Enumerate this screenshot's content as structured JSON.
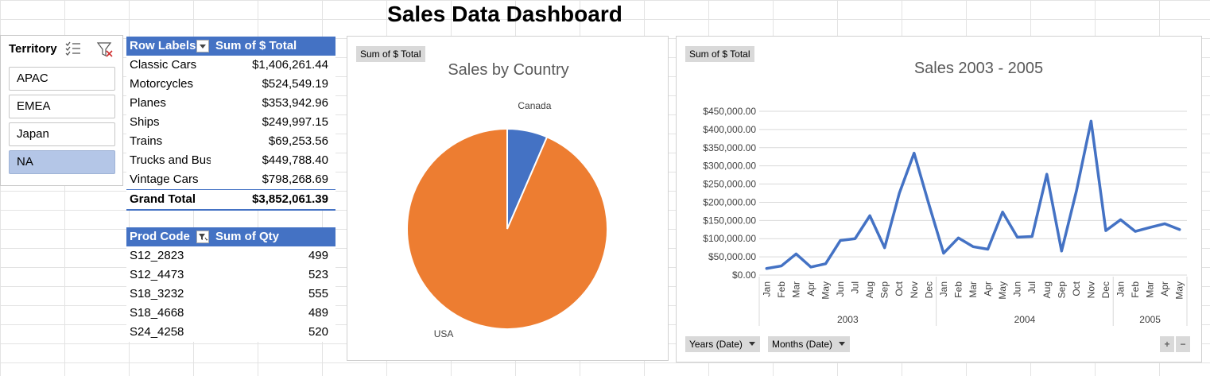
{
  "title": "Sales Data Dashboard",
  "slicer": {
    "header": "Territory",
    "items": [
      {
        "label": "APAC",
        "selected": false
      },
      {
        "label": "EMEA",
        "selected": false
      },
      {
        "label": "Japan",
        "selected": false
      },
      {
        "label": "NA",
        "selected": true
      }
    ]
  },
  "pivot1": {
    "col1": "Row Labels",
    "col2": "Sum of $ Total",
    "rows": [
      {
        "label": "Classic Cars",
        "value": "$1,406,261.44"
      },
      {
        "label": "Motorcycles",
        "value": "$524,549.19"
      },
      {
        "label": "Planes",
        "value": "$353,942.96"
      },
      {
        "label": "Ships",
        "value": "$249,997.15"
      },
      {
        "label": "Trains",
        "value": "$69,253.56"
      },
      {
        "label": "Trucks and Buses",
        "value": "$449,788.40"
      },
      {
        "label": "Vintage Cars",
        "value": "$798,268.69"
      }
    ],
    "grand_label": "Grand Total",
    "grand_value": "$3,852,061.39"
  },
  "pivot2": {
    "col1": "Prod Code",
    "col2": "Sum of Qty",
    "rows": [
      {
        "label": "S12_2823",
        "value": "499"
      },
      {
        "label": "S12_4473",
        "value": "523"
      },
      {
        "label": "S18_3232",
        "value": "555"
      },
      {
        "label": "S18_4668",
        "value": "489"
      },
      {
        "label": "S24_4258",
        "value": "520"
      }
    ]
  },
  "pie_panel": {
    "field_button": "Sum of $ Total"
  },
  "line_panel": {
    "field_button": "Sum of $ Total",
    "axis_buttons": [
      "Years (Date)",
      "Months (Date)"
    ],
    "zoom_in": "+",
    "zoom_out": "−"
  },
  "colors": {
    "accent": "#4472c4",
    "orange": "#ed7d31",
    "selected": "#b4c6e7"
  },
  "chart_data": [
    {
      "type": "pie",
      "title": "Sales by Country",
      "categories": [
        "Canada",
        "USA"
      ],
      "values": [
        6.5,
        93.5
      ],
      "colors": [
        "#4472c4",
        "#ed7d31"
      ]
    },
    {
      "type": "line",
      "title": "Sales 2003 - 2005",
      "months": [
        "Jan",
        "Feb",
        "Mar",
        "Apr",
        "May",
        "Jun",
        "Jul",
        "Aug",
        "Sep",
        "Oct",
        "Nov",
        "Dec",
        "Jan",
        "Feb",
        "Mar",
        "Apr",
        "May",
        "Jun",
        "Jul",
        "Aug",
        "Sep",
        "Oct",
        "Nov",
        "Dec",
        "Jan",
        "Feb",
        "Mar",
        "Apr",
        "May"
      ],
      "years": [
        {
          "label": "2003",
          "count": 12
        },
        {
          "label": "2004",
          "count": 12
        },
        {
          "label": "2005",
          "count": 5
        }
      ],
      "values": [
        18000,
        25000,
        58000,
        22000,
        31000,
        95000,
        100000,
        163000,
        75000,
        225000,
        335000,
        195000,
        60000,
        102000,
        78000,
        71000,
        173000,
        104000,
        106000,
        277000,
        66000,
        230000,
        423000,
        122000,
        152000,
        120000,
        131000,
        141000,
        125000
      ],
      "ylim": [
        0,
        450000
      ],
      "yticks": [
        "$0.00",
        "$50,000.00",
        "$100,000.00",
        "$150,000.00",
        "$200,000.00",
        "$250,000.00",
        "$300,000.00",
        "$350,000.00",
        "$400,000.00",
        "$450,000.00"
      ],
      "grid": true,
      "color": "#4472c4"
    }
  ]
}
